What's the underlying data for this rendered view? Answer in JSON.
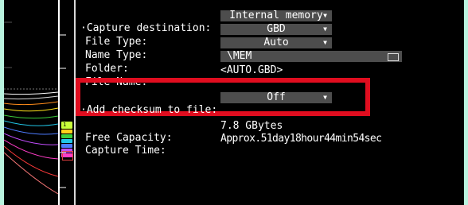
{
  "colors": {
    "highlight": "#e00d1f",
    "dropdown_bg": "#4d4d4d",
    "page_bg": "#b9f3df"
  },
  "settings": {
    "capture_destination": {
      "label": "·Capture destination:",
      "value": "Internal memory"
    },
    "file_type": {
      "label": "File Type:",
      "value": "GBD"
    },
    "name_type": {
      "label": "Name Type:",
      "value": "Auto"
    },
    "folder": {
      "label": "Folder:",
      "value": "\\MEM"
    },
    "file_name": {
      "label": "File Name:",
      "value": "<AUTO.GBD>"
    },
    "add_checksum": {
      "label": "·Add checksum to file:",
      "value": "Off"
    },
    "free_capacity": {
      "label": "Free Capacity:",
      "value": "7.8 GBytes"
    },
    "capture_time": {
      "label": "Capture Time:",
      "value": "Approx.51day18hour44min54sec"
    }
  },
  "icons": {
    "dropdown": "caret-down-icon",
    "folder": "folder-browse-icon"
  },
  "channel_marker_label": "1"
}
